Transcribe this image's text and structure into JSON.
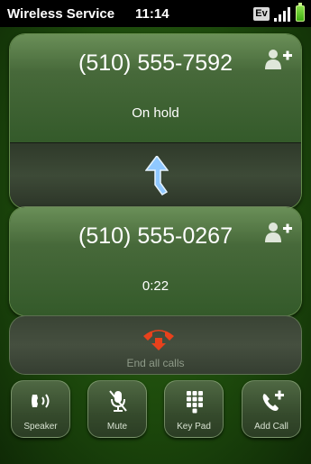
{
  "status_bar": {
    "carrier": "Wireless Service",
    "time": "11:14",
    "network": "Ev"
  },
  "calls": [
    {
      "number": "(510) 555-7592",
      "status": "On hold"
    },
    {
      "number": "(510) 555-0267",
      "status": "0:22"
    }
  ],
  "end_all_label": "End all calls",
  "buttons": [
    {
      "label": "Speaker",
      "icon": "speaker-icon"
    },
    {
      "label": "Mute",
      "icon": "mute-icon"
    },
    {
      "label": "Key Pad",
      "icon": "keypad-icon"
    },
    {
      "label": "Add Call",
      "icon": "add-call-icon"
    }
  ],
  "colors": {
    "background": "#1d4a0c",
    "end_call_red": "#e8411c",
    "swap_arrow_blue": "#8fc8ff"
  }
}
